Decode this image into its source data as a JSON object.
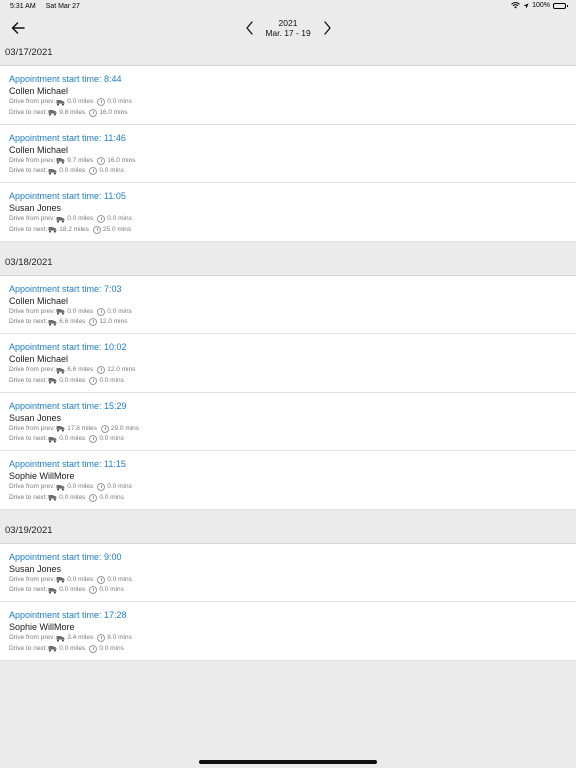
{
  "status_bar": {
    "time": "5:31 AM",
    "date": "Sat Mar 27",
    "battery": "100%"
  },
  "nav": {
    "year": "2021",
    "range": "Mar. 17 - 19"
  },
  "days": [
    {
      "date": "03/17/2021",
      "appointments": [
        {
          "title": "Appointment start time: 8:44",
          "name": "Collen Michael",
          "from_label": "Drive from prev:",
          "from_miles": "0.0 miles",
          "from_mins": "0.0 mins",
          "to_label": "Drive to next:",
          "to_miles": "9.8 miles",
          "to_mins": "16.0 mins"
        },
        {
          "title": "Appointment start time: 11:46",
          "name": "Collen Michael",
          "from_label": "Drive from prev:",
          "from_miles": "9.7 miles",
          "from_mins": "16.0 mins",
          "to_label": "Drive to next:",
          "to_miles": "0.0 miles",
          "to_mins": "0.0 mins"
        },
        {
          "title": "Appointment start time: 11:05",
          "name": "Susan Jones",
          "from_label": "Drive from prev:",
          "from_miles": "0.0 miles",
          "from_mins": "0.0 mins",
          "to_label": "Drive to next:",
          "to_miles": "18.2 miles",
          "to_mins": "25.0 mins"
        }
      ]
    },
    {
      "date": "03/18/2021",
      "appointments": [
        {
          "title": "Appointment start time: 7:03",
          "name": "Collen Michael",
          "from_label": "Drive from prev:",
          "from_miles": "0.0 miles",
          "from_mins": "0.0 mins",
          "to_label": "Drive to next:",
          "to_miles": "6.6 miles",
          "to_mins": "12.0 mins"
        },
        {
          "title": "Appointment start time: 10:02",
          "name": "Collen Michael",
          "from_label": "Drive from prev:",
          "from_miles": "6.6 miles",
          "from_mins": "12.0 mins",
          "to_label": "Drive to next:",
          "to_miles": "0.0 miles",
          "to_mins": "0.0 mins"
        },
        {
          "title": "Appointment start time: 15:29",
          "name": "Susan Jones",
          "from_label": "Drive from prev:",
          "from_miles": "17.8 miles",
          "from_mins": "29.0 mins",
          "to_label": "Drive to next:",
          "to_miles": "0.0 miles",
          "to_mins": "0.0 mins"
        },
        {
          "title": "Appointment start time: 11:15",
          "name": "Sophie WillMore",
          "from_label": "Drive from prev:",
          "from_miles": "0.0 miles",
          "from_mins": "0.0 mins",
          "to_label": "Drive to next:",
          "to_miles": "0.0 miles",
          "to_mins": "0.0 mins"
        }
      ]
    },
    {
      "date": "03/19/2021",
      "appointments": [
        {
          "title": "Appointment start time: 9:00",
          "name": "Susan Jones",
          "from_label": "Drive from prev:",
          "from_miles": "0.0 miles",
          "from_mins": "0.0 mins",
          "to_label": "Drive to next:",
          "to_miles": "0.0 miles",
          "to_mins": "0.0 mins"
        },
        {
          "title": "Appointment start time: 17:28",
          "name": "Sophie WillMore",
          "from_label": "Drive from prev:",
          "from_miles": "3.4 miles",
          "from_mins": "8.0 mins",
          "to_label": "Drive to next:",
          "to_miles": "0.0 miles",
          "to_mins": "0.0 mins"
        }
      ]
    }
  ],
  "icons": {
    "back": "arrow-left-icon",
    "prev": "chevron-left-icon",
    "next": "chevron-right-icon",
    "vehicle": "truck-icon",
    "time": "clock-icon"
  },
  "colors": {
    "accent": "#1f7dc4",
    "background": "#ebebeb",
    "card": "#ffffff"
  }
}
